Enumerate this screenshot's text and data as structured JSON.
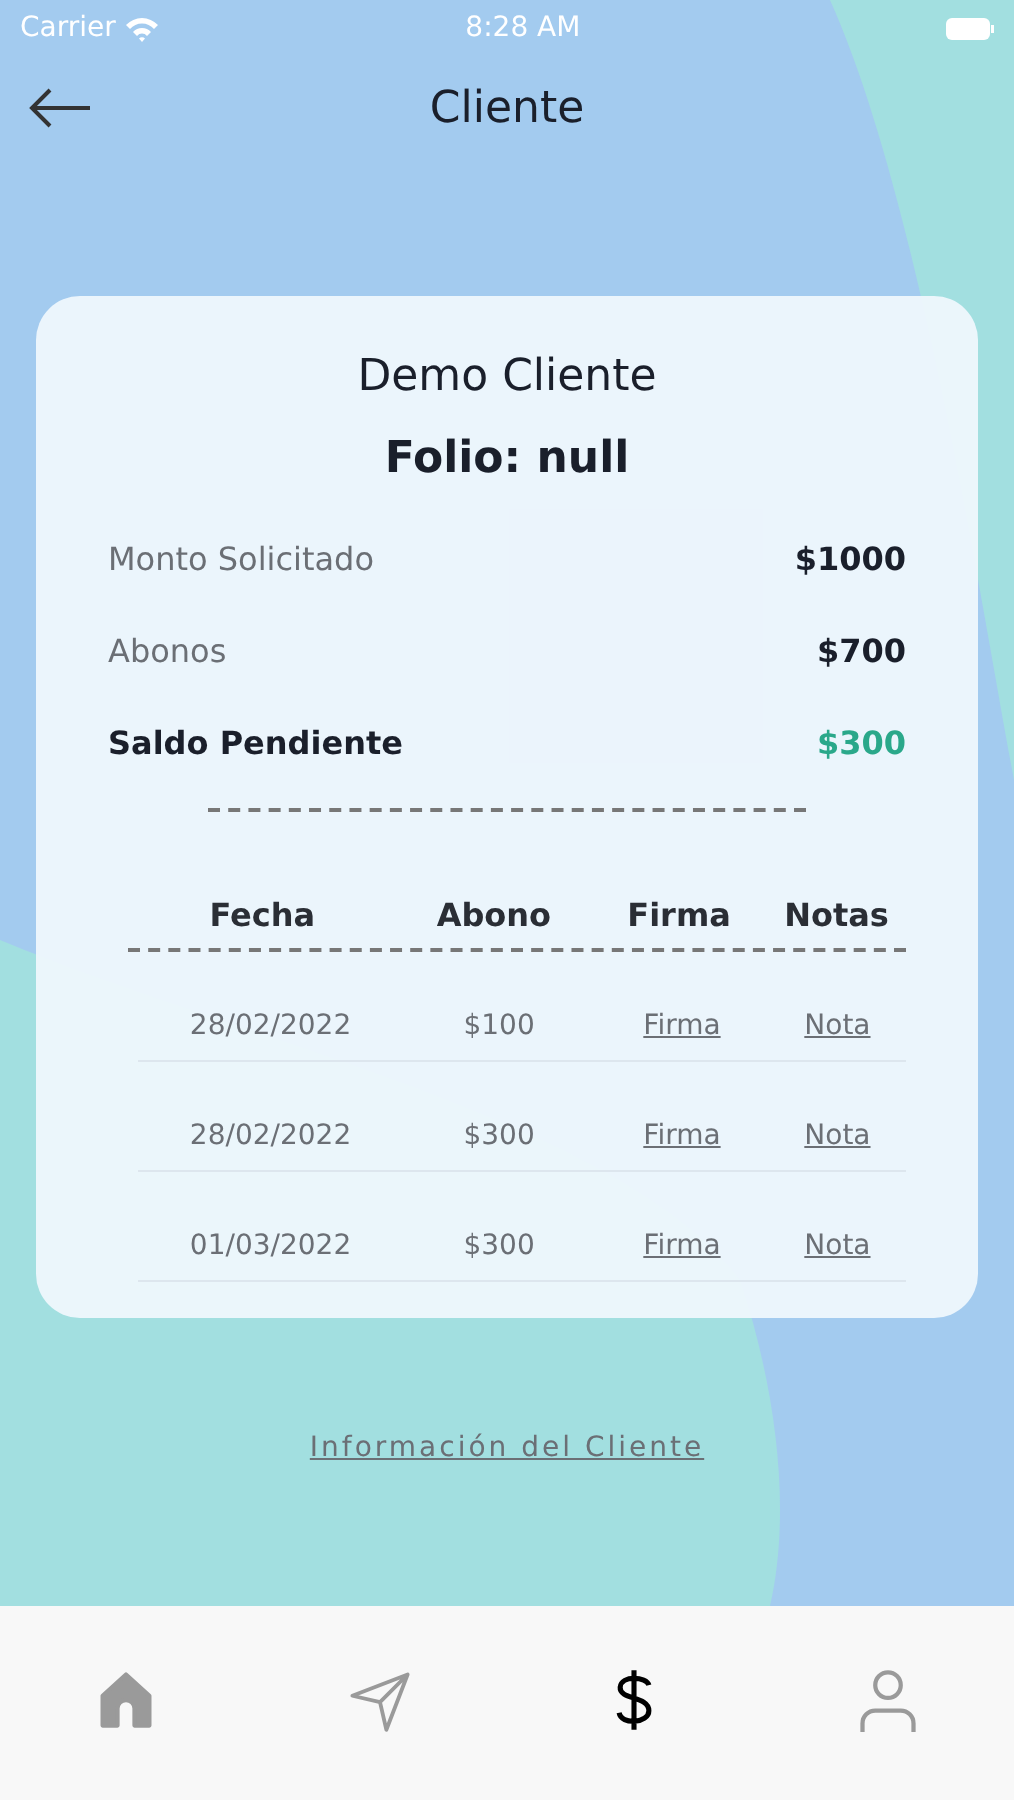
{
  "status_bar": {
    "carrier": "Carrier",
    "time": "8:28 AM"
  },
  "header": {
    "title": "Cliente"
  },
  "card": {
    "name": "Demo Cliente",
    "folio": "Folio: null",
    "summary": [
      {
        "label": "Monto Solicitado",
        "value": "$1000",
        "kind": "normal"
      },
      {
        "label": "Abonos",
        "value": "$700",
        "kind": "normal"
      },
      {
        "label": "Saldo Pendiente",
        "value": "$300",
        "kind": "total"
      }
    ],
    "table": {
      "columns": [
        "Fecha",
        "Abono",
        "Firma",
        "Notas"
      ],
      "rows": [
        {
          "date": "28/02/2022",
          "amount": "$100",
          "signature": "Firma",
          "note": "Nota"
        },
        {
          "date": "28/02/2022",
          "amount": "$300",
          "signature": "Firma",
          "note": "Nota"
        },
        {
          "date": "01/03/2022",
          "amount": "$300",
          "signature": "Firma",
          "note": "Nota"
        }
      ]
    }
  },
  "link": "Información del Cliente",
  "tab_bar": [
    {
      "kind": "home",
      "selected": false
    },
    {
      "kind": "send",
      "selected": false
    },
    {
      "kind": "dollar",
      "selected": true
    },
    {
      "kind": "user",
      "selected": false
    }
  ]
}
